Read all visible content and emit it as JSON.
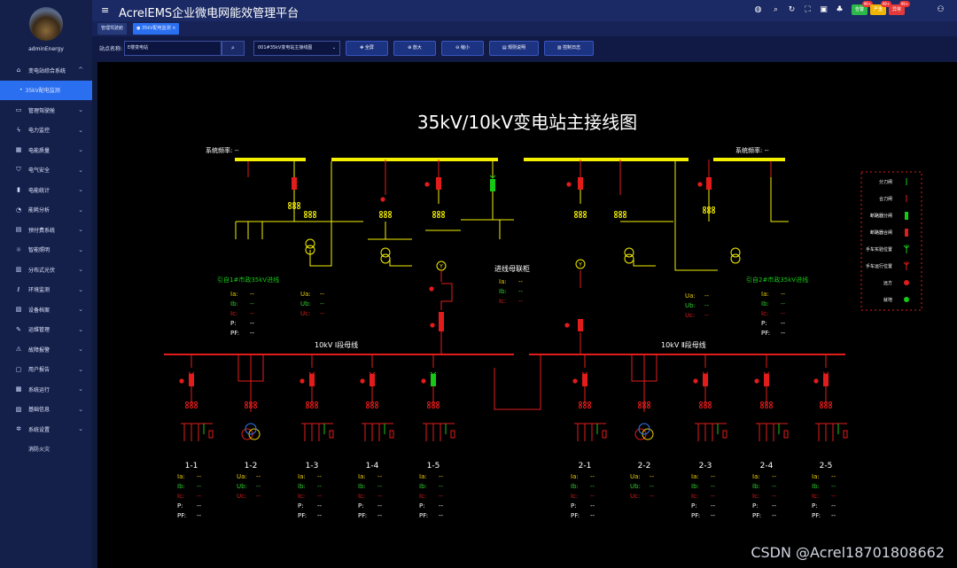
{
  "app": {
    "title": "AcrelEMS企业微电网能效管理平台"
  },
  "user": {
    "name": "adminEnergy"
  },
  "sidebar": {
    "items": [
      {
        "label": "变电站综合系统",
        "icon": "home-icon",
        "expanded": true
      },
      {
        "label": "35kV配电监测",
        "sub": true,
        "active": true
      },
      {
        "label": "管理驾驶舱",
        "icon": "monitor-icon"
      },
      {
        "label": "电力监控",
        "icon": "bolt-icon"
      },
      {
        "label": "电能质量",
        "icon": "grid-icon"
      },
      {
        "label": "电气安全",
        "icon": "shield-icon"
      },
      {
        "label": "电能统计",
        "icon": "bar-chart-icon"
      },
      {
        "label": "能耗分析",
        "icon": "pie-icon"
      },
      {
        "label": "预付费系统",
        "icon": "wallet-icon"
      },
      {
        "label": "智能照明",
        "icon": "bulb-icon"
      },
      {
        "label": "分布式光伏",
        "icon": "solar-icon"
      },
      {
        "label": "环境监测",
        "icon": "thermometer-icon"
      },
      {
        "label": "设备档案",
        "icon": "archive-icon"
      },
      {
        "label": "运维管理",
        "icon": "tools-icon"
      },
      {
        "label": "故障报警",
        "icon": "alarm-icon"
      },
      {
        "label": "用户报告",
        "icon": "report-icon"
      },
      {
        "label": "系统运行",
        "icon": "run-icon"
      },
      {
        "label": "基础信息",
        "icon": "info-icon"
      },
      {
        "label": "系统设置",
        "icon": "settings-icon"
      },
      {
        "label": "消防火灾",
        "icon": "fire-icon"
      }
    ]
  },
  "header": {
    "badges": [
      {
        "label": "告警",
        "count": "99+",
        "color": "#2db84a"
      },
      {
        "label": "严重",
        "count": "99+",
        "color": "#f0b400"
      },
      {
        "label": "异常",
        "count": "99+",
        "color": "#e23a3a"
      }
    ]
  },
  "tabs": [
    {
      "label": "管理驾驶舱",
      "active": false
    },
    {
      "label": "35kV配电监测",
      "active": true,
      "closable": "×"
    }
  ],
  "toolbar": {
    "station_label": "站点名称:",
    "station_value": "E楼变电站",
    "diagram_select": "001#35kV变电站主接线图",
    "buttons": [
      {
        "label": "全屏",
        "icon": "✥"
      },
      {
        "label": "放大",
        "icon": "⊕"
      },
      {
        "label": "缩小",
        "icon": "⊖"
      },
      {
        "label": "规则说明",
        "icon": "▤"
      },
      {
        "label": "控制日志",
        "icon": "▥"
      }
    ]
  },
  "diagram": {
    "title": "35kV/10kV变电站主接线图",
    "freq_left": "系统频率: --",
    "freq_right": "系统频率: --",
    "incoming1": "引自1#市政35kV进线",
    "incoming2": "引自2#市政35kV进线",
    "tie_cabinet": "进线母联柜",
    "bus1": "10kV Ⅰ段母线",
    "bus2": "10kV Ⅱ段母线",
    "placeholder": "--",
    "meter_labels": {
      "Ia": "Ia:",
      "Ib": "Ib:",
      "Ic": "Ic:",
      "P": "P:",
      "PF": "PF:",
      "Ua": "Ua:",
      "Ub": "Ub:",
      "Uc": "Uc:"
    },
    "feeders": [
      "1-1",
      "1-2",
      "1-3",
      "1-4",
      "1-5",
      "2-1",
      "2-2",
      "2-3",
      "2-4",
      "2-5"
    ],
    "legend": [
      {
        "label": "分刀闸",
        "kind": "switch-open"
      },
      {
        "label": "合刀闸",
        "kind": "switch-closed"
      },
      {
        "label": "断路器分闸",
        "kind": "breaker-open"
      },
      {
        "label": "断路器合闸",
        "kind": "breaker-closed"
      },
      {
        "label": "手车实验位置",
        "kind": "cart-test"
      },
      {
        "label": "手车运行位置",
        "kind": "cart-run"
      },
      {
        "label": "远方",
        "kind": "remote"
      },
      {
        "label": "就地",
        "kind": "local"
      }
    ]
  },
  "colors": {
    "bus": "#f5f000",
    "live": "#e21b1b",
    "off": "#16c916",
    "phaseA": "#f0d000",
    "phaseB": "#2fd02f",
    "phaseC": "#e21b1b"
  },
  "watermark": "CSDN @Acrel18701808662"
}
